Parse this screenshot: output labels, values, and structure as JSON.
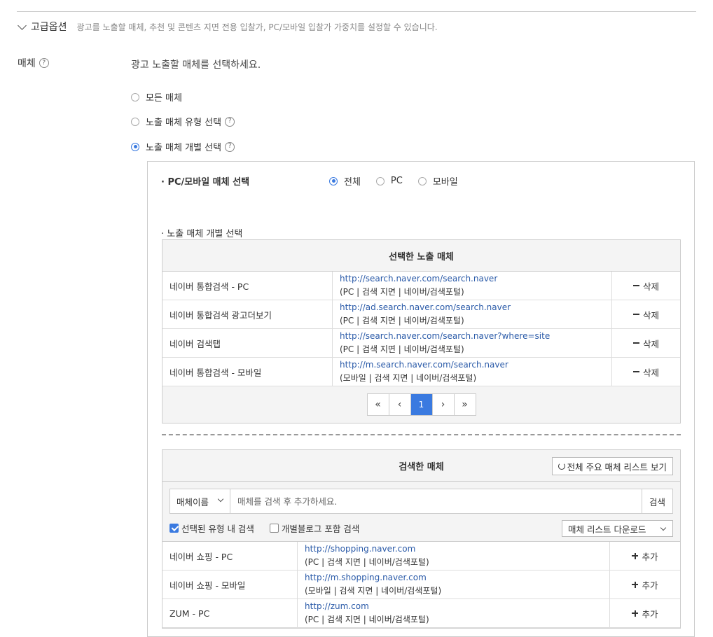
{
  "advanced": {
    "title": "고급옵션",
    "description": "광고를 노출할 매체, 추천 및 콘텐츠 지면 전용 입찰가, PC/모바일 입찰가 가중치를 설정할 수 있습니다."
  },
  "media": {
    "label": "매체",
    "help": "?",
    "instruction": "광고 노출할 매체를 선택하세요.",
    "options": [
      {
        "label": "모든 매체",
        "selected": false,
        "help": ""
      },
      {
        "label": "노출 매체 유형 선택",
        "selected": false,
        "help": "?"
      },
      {
        "label": "노출 매체 개별 선택",
        "selected": true,
        "help": "?"
      }
    ]
  },
  "panel": {
    "scope_title": "· PC/모바일 매체 선택",
    "scope_options": [
      {
        "label": "전체",
        "selected": true
      },
      {
        "label": "PC",
        "selected": false
      },
      {
        "label": "모바일",
        "selected": false
      }
    ],
    "individual_title": "· 노출 매체 개별 선택"
  },
  "selected_table": {
    "header": "선택한 노출 매체",
    "remove_label": "삭제",
    "rows": [
      {
        "name": "네이버 통합검색 - PC",
        "url": "http://search.naver.com/search.naver",
        "info": "(PC | 검색 지면 | 네이버/검색포털)"
      },
      {
        "name": "네이버 통합검색 광고더보기",
        "url": "http://ad.search.naver.com/search.naver",
        "info": "(PC | 검색 지면 | 네이버/검색포털)"
      },
      {
        "name": "네이버 검색탭",
        "url": "http://search.naver.com/search.naver?where=site",
        "info": "(PC | 검색 지면 | 네이버/검색포털)"
      },
      {
        "name": "네이버 통합검색 - 모바일",
        "url": "http://m.search.naver.com/search.naver",
        "info": "(모바일 | 검색 지면 | 네이버/검색포털)"
      }
    ],
    "pager": {
      "first": "«",
      "prev": "‹",
      "current": "1",
      "next": "›",
      "last": "»"
    }
  },
  "search_table": {
    "header": "검색한 매체",
    "full_list_button": "전체 주요 매체 리스트 보기",
    "select_value": "매체이름",
    "input_placeholder": "매체를 검색 후 추가하세요.",
    "search_button": "검색",
    "check_selected_type": "선택된 유형 내 검색",
    "check_selected_type_on": true,
    "check_blog": "개별블로그 포함 검색",
    "check_blog_on": false,
    "download_button": "매체 리스트 다운로드",
    "add_label": "추가",
    "rows": [
      {
        "name": "네이버 쇼핑 - PC",
        "url": "http://shopping.naver.com",
        "info": "(PC | 검색 지면 | 네이버/검색포털)"
      },
      {
        "name": "네이버 쇼핑 - 모바일",
        "url": "http://m.shopping.naver.com",
        "info": "(모바일 | 검색 지면 | 네이버/검색포털)"
      },
      {
        "name": "ZUM - PC",
        "url": "http://zum.com",
        "info": "(PC | 검색 지면 | 네이버/검색포털)"
      }
    ]
  },
  "colors": {
    "accent": "#3a7ae0",
    "link": "#2a5aa8"
  }
}
